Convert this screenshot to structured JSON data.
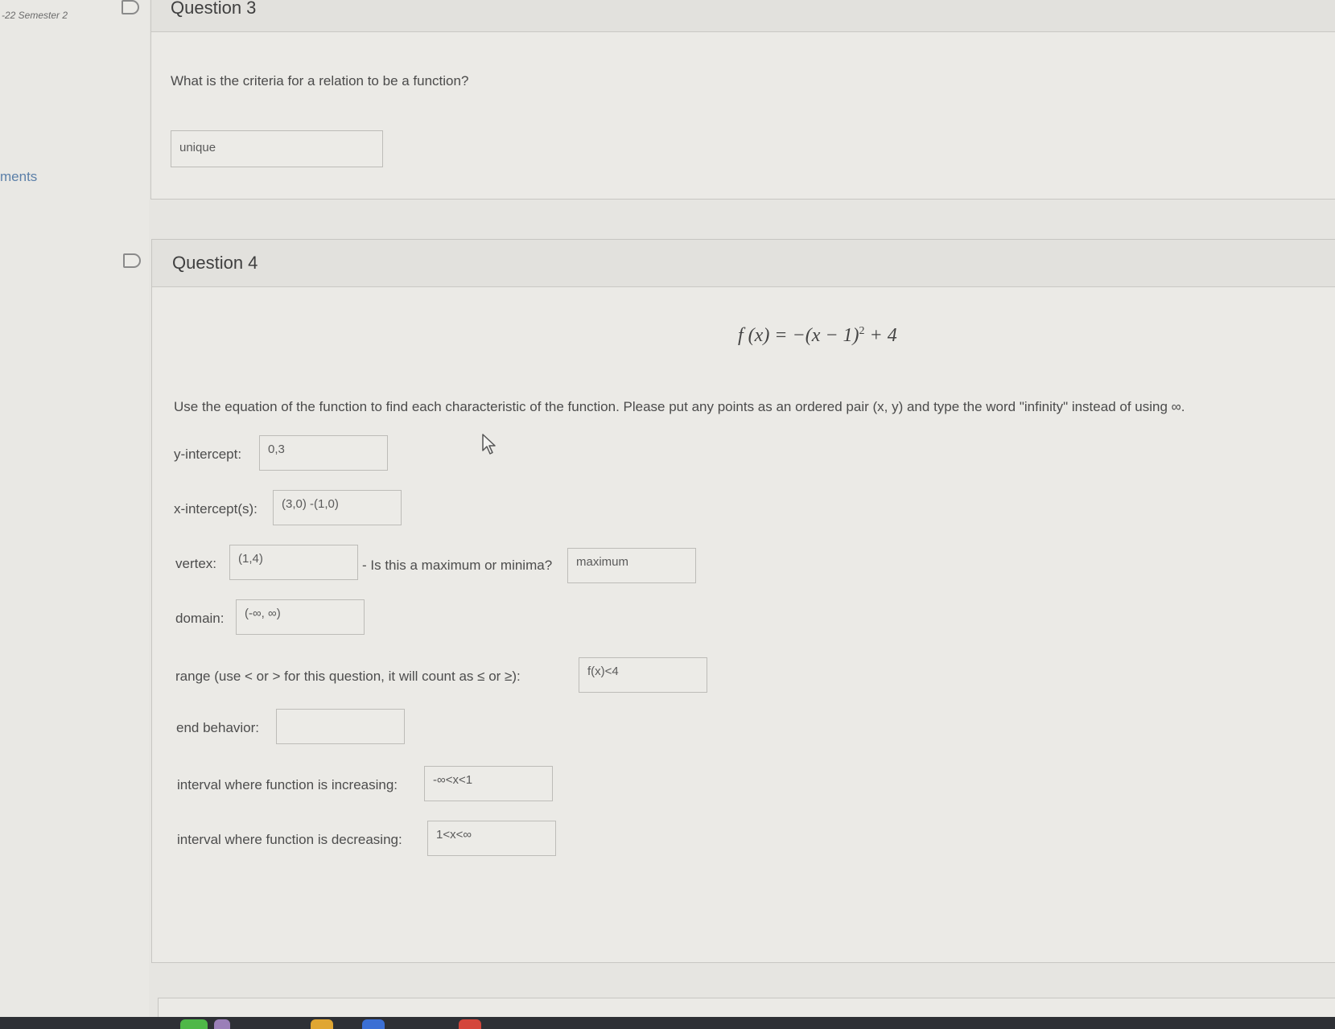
{
  "sidebar": {
    "course_label": "-22 Semester 2",
    "link_label": "ments"
  },
  "question3": {
    "title": "Question 3",
    "prompt": "What is the criteria for a relation to be a function?",
    "answer": "unique"
  },
  "question4": {
    "title": "Question 4",
    "equation": {
      "lhs": "f (x) = −(x − 1)",
      "exponent": "2",
      "rhs": " + 4"
    },
    "instructions": "Use the equation of the function to find each characteristic of the function. Please put any points as an ordered pair (x, y) and type the word \"infinity\" instead of using ∞.",
    "fields": {
      "y_intercept": {
        "label": "y-intercept:",
        "value": "0,3"
      },
      "x_intercepts": {
        "label": "x-intercept(s):",
        "value": "(3,0) -(1,0)"
      },
      "vertex": {
        "label": "vertex:",
        "value": "(1,4)"
      },
      "max_min": {
        "label": "- Is this a maximum or minima?",
        "value": "maximum"
      },
      "domain": {
        "label": "domain:",
        "value": "(-∞, ∞)"
      },
      "range": {
        "label": "range (use < or > for this question, it will count as ≤  or  ≥):",
        "value": "f(x)<4"
      },
      "end_behavior": {
        "label": "end behavior:",
        "value": ""
      },
      "increasing": {
        "label": "interval where function is increasing:",
        "value": "-∞<x<1"
      },
      "decreasing": {
        "label": "interval where function is decreasing:",
        "value": "1<x<∞"
      }
    }
  },
  "colors": {
    "background": "#e6e5e1",
    "card": "#ebeae6",
    "link": "#5b7fa8",
    "taskbar": "#2e3035"
  },
  "icons": [
    "flag-icon",
    "mouse-pointer-icon"
  ]
}
